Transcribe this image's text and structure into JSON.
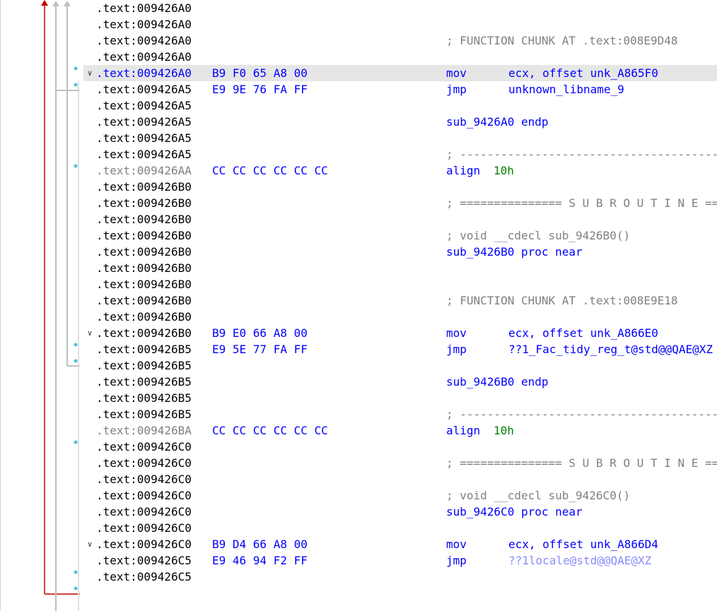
{
  "rows": [
    {
      "addr": ".text:009426A0",
      "bytes": "",
      "mnemonic": "",
      "operands": "",
      "comment": "",
      "name": ""
    },
    {
      "addr": ".text:009426A0",
      "bytes": "",
      "mnemonic": "",
      "operands": "",
      "comment": "",
      "name": ""
    },
    {
      "addr": ".text:009426A0",
      "bytes": "",
      "mnemonic": "",
      "operands": "",
      "comment": "; FUNCTION CHUNK AT .text:008E9D48",
      "name": ""
    },
    {
      "addr": ".text:009426A0",
      "bytes": "",
      "mnemonic": "",
      "operands": "",
      "comment": "",
      "name": ""
    },
    {
      "addr": ".text:009426A0",
      "bytes": "B9 F0 65 A8 00",
      "mnemonic": "mov",
      "operands": "ecx, offset unk_A865F0",
      "comment": "",
      "name": ""
    },
    {
      "addr": ".text:009426A5",
      "bytes": "E9 9E 76 FA FF",
      "mnemonic": "jmp",
      "operands": "unknown_libname_9",
      "comment": "",
      "name": ""
    },
    {
      "addr": ".text:009426A5",
      "bytes": "",
      "mnemonic": "",
      "operands": "",
      "comment": "",
      "name": ""
    },
    {
      "addr": ".text:009426A5",
      "bytes": "",
      "mnemonic": "",
      "operands": "",
      "comment": "",
      "name": "sub_9426A0 endp"
    },
    {
      "addr": ".text:009426A5",
      "bytes": "",
      "mnemonic": "",
      "operands": "",
      "comment": "",
      "name": ""
    },
    {
      "addr": ".text:009426A5",
      "bytes": "",
      "mnemonic": "",
      "operands": "",
      "comment": "; ---------------------------------------------------------------------------",
      "name": ""
    },
    {
      "addr": ".text:009426AA",
      "bytes": "CC CC CC CC CC CC",
      "mnemonic": "align",
      "operands": "10h",
      "comment": "",
      "name": ""
    },
    {
      "addr": ".text:009426B0",
      "bytes": "",
      "mnemonic": "",
      "operands": "",
      "comment": "",
      "name": ""
    },
    {
      "addr": ".text:009426B0",
      "bytes": "",
      "mnemonic": "",
      "operands": "",
      "comment": "; =============== S U B R O U T I N E =======================================",
      "name": ""
    },
    {
      "addr": ".text:009426B0",
      "bytes": "",
      "mnemonic": "",
      "operands": "",
      "comment": "",
      "name": ""
    },
    {
      "addr": ".text:009426B0",
      "bytes": "",
      "mnemonic": "",
      "operands": "",
      "comment": "; void __cdecl sub_9426B0()",
      "name": ""
    },
    {
      "addr": ".text:009426B0",
      "bytes": "",
      "mnemonic": "",
      "operands": "",
      "comment": "",
      "name": "sub_9426B0 proc near"
    },
    {
      "addr": ".text:009426B0",
      "bytes": "",
      "mnemonic": "",
      "operands": "",
      "comment": "",
      "name": ""
    },
    {
      "addr": ".text:009426B0",
      "bytes": "",
      "mnemonic": "",
      "operands": "",
      "comment": "",
      "name": ""
    },
    {
      "addr": ".text:009426B0",
      "bytes": "",
      "mnemonic": "",
      "operands": "",
      "comment": "; FUNCTION CHUNK AT .text:008E9E18",
      "name": ""
    },
    {
      "addr": ".text:009426B0",
      "bytes": "",
      "mnemonic": "",
      "operands": "",
      "comment": "",
      "name": ""
    },
    {
      "addr": ".text:009426B0",
      "bytes": "B9 E0 66 A8 00",
      "mnemonic": "mov",
      "operands": "ecx, offset unk_A866E0",
      "comment": "",
      "name": ""
    },
    {
      "addr": ".text:009426B5",
      "bytes": "E9 5E 77 FA FF",
      "mnemonic": "jmp",
      "operands": "??1_Fac_tidy_reg_t@std@@QAE@XZ",
      "comment": "",
      "name": ""
    },
    {
      "addr": ".text:009426B5",
      "bytes": "",
      "mnemonic": "",
      "operands": "",
      "comment": "",
      "name": ""
    },
    {
      "addr": ".text:009426B5",
      "bytes": "",
      "mnemonic": "",
      "operands": "",
      "comment": "",
      "name": "sub_9426B0 endp"
    },
    {
      "addr": ".text:009426B5",
      "bytes": "",
      "mnemonic": "",
      "operands": "",
      "comment": "",
      "name": ""
    },
    {
      "addr": ".text:009426B5",
      "bytes": "",
      "mnemonic": "",
      "operands": "",
      "comment": "; ---------------------------------------------------------------------------",
      "name": ""
    },
    {
      "addr": ".text:009426BA",
      "bytes": "CC CC CC CC CC CC",
      "mnemonic": "align",
      "operands": "10h",
      "comment": "",
      "name": ""
    },
    {
      "addr": ".text:009426C0",
      "bytes": "",
      "mnemonic": "",
      "operands": "",
      "comment": "",
      "name": ""
    },
    {
      "addr": ".text:009426C0",
      "bytes": "",
      "mnemonic": "",
      "operands": "",
      "comment": "; =============== S U B R O U T I N E =======================================",
      "name": ""
    },
    {
      "addr": ".text:009426C0",
      "bytes": "",
      "mnemonic": "",
      "operands": "",
      "comment": "",
      "name": ""
    },
    {
      "addr": ".text:009426C0",
      "bytes": "",
      "mnemonic": "",
      "operands": "",
      "comment": "; void __cdecl sub_9426C0()",
      "name": ""
    },
    {
      "addr": ".text:009426C0",
      "bytes": "",
      "mnemonic": "",
      "operands": "",
      "comment": "",
      "name": "sub_9426C0 proc near"
    },
    {
      "addr": ".text:009426C0",
      "bytes": "",
      "mnemonic": "",
      "operands": "",
      "comment": "",
      "name": ""
    },
    {
      "addr": ".text:009426C0",
      "bytes": "B9 D4 66 A8 00",
      "mnemonic": "mov",
      "operands": "ecx, offset unk_A866D4",
      "comment": "",
      "name": ""
    },
    {
      "addr": ".text:009426C5",
      "bytes": "E9 46 94 F2 FF",
      "mnemonic": "jmp",
      "operands": "??1locale@std@@QAE@XZ",
      "comment": "",
      "name": ""
    },
    {
      "addr": ".text:009426C5",
      "bytes": "",
      "mnemonic": "",
      "operands": "",
      "comment": "",
      "name": ""
    }
  ],
  "colors": {
    "address": "#000000",
    "address_current": "#0000ff",
    "address_align": "#808080",
    "bytes": "#0000ff",
    "mnemonic": "#0000ff",
    "operand": "#0000ff",
    "operand_external": "#8a8aff",
    "comment": "#808080",
    "number": "#008000",
    "highlight_row": "#e6e6e6",
    "jump_arrow": "#c00000",
    "flow_line": "#c0c0c0",
    "bp_dot": "#4fc1e9"
  }
}
